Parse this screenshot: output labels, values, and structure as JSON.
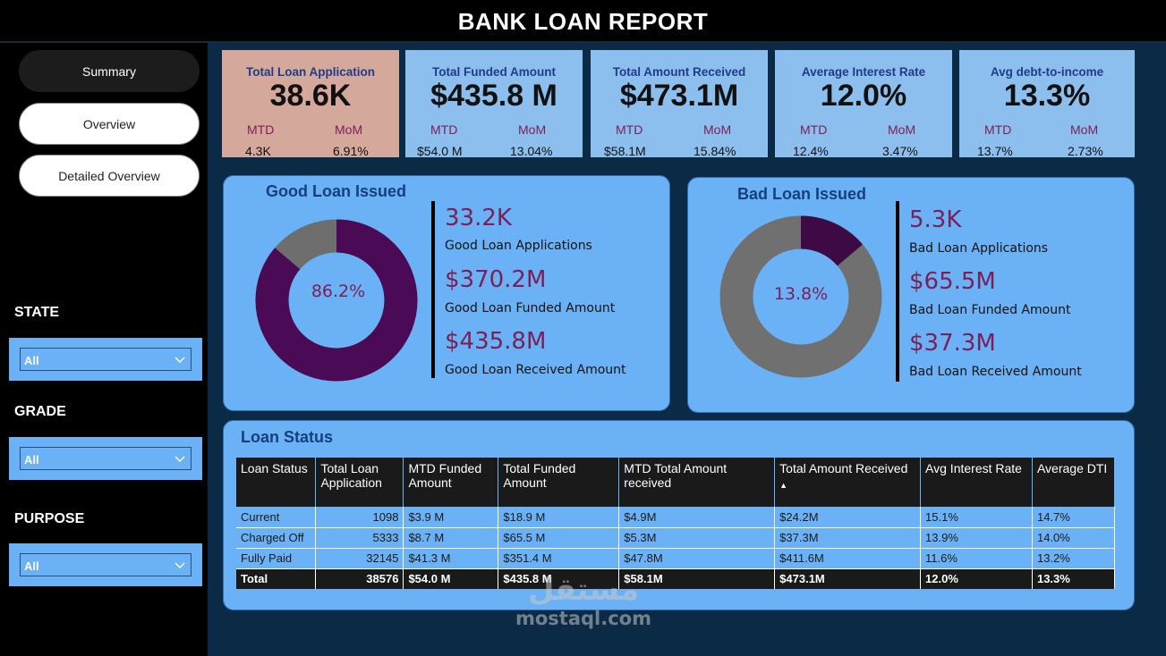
{
  "header": {
    "title": "BANK LOAN REPORT"
  },
  "nav": {
    "summary": "Summary",
    "overview": "Overview",
    "detailed": "Detailed Overview"
  },
  "filters": {
    "state": {
      "label": "STATE",
      "value": "All"
    },
    "grade": {
      "label": "GRADE",
      "value": "All"
    },
    "purpose": {
      "label": "PURPOSE",
      "value": "All"
    }
  },
  "kpis": [
    {
      "title": "Total Loan Application",
      "value": "38.6K",
      "mtd_label": "MTD",
      "mom_label": "MoM",
      "mtd": "4.3K",
      "mom": "6.91%"
    },
    {
      "title": "Total Funded Amount",
      "value": "$435.8 M",
      "mtd_label": "MTD",
      "mom_label": "MoM",
      "mtd": "$54.0 M",
      "mom": "13.04%"
    },
    {
      "title": "Total Amount Received",
      "value": "$473.1M",
      "mtd_label": "MTD",
      "mom_label": "MoM",
      "mtd": "$58.1M",
      "mom": "15.84%"
    },
    {
      "title": "Average Interest Rate",
      "value": "12.0%",
      "mtd_label": "MTD",
      "mom_label": "MoM",
      "mtd": "12.4%",
      "mom": "3.47%"
    },
    {
      "title": "Avg debt-to-income",
      "value": "13.3%",
      "mtd_label": "MTD",
      "mom_label": "MoM",
      "mtd": "13.7%",
      "mom": "2.73%"
    }
  ],
  "good_loan": {
    "title": "Good Loan Issued",
    "percent_label": "86.2%",
    "percent": 86.2,
    "applications": "33.2K",
    "applications_label": "Good Loan Applications",
    "funded": "$370.2M",
    "funded_label": "Good Loan Funded Amount",
    "received": "$435.8M",
    "received_label": "Good Loan Received Amount",
    "fill_color": "#4a0a55",
    "rest_color": "#6e6e6e"
  },
  "bad_loan": {
    "title": "Bad Loan Issued",
    "percent_label": "13.8%",
    "percent": 13.8,
    "applications": "5.3K",
    "applications_label": "Bad Loan Applications",
    "funded": "$65.5M",
    "funded_label": "Bad Loan Funded Amount",
    "received": "$37.3M",
    "received_label": "Bad Loan Received Amount",
    "fill_color": "#3d0a45",
    "rest_color": "#707070"
  },
  "loan_status": {
    "title": "Loan Status",
    "columns": [
      "Loan Status",
      "Total Loan Application",
      "MTD Funded Amount",
      "Total Funded Amount",
      "MTD Total Amount received",
      "Total Amount Received",
      "Avg Interest Rate",
      "Average DTI"
    ],
    "rows": [
      [
        "Current",
        "1098",
        "$3.9 M",
        "$18.9 M",
        "$4.9M",
        "$24.2M",
        "15.1%",
        "14.7%"
      ],
      [
        "Charged Off",
        "5333",
        "$8.7 M",
        "$65.5 M",
        "$5.3M",
        "$37.3M",
        "13.9%",
        "14.0%"
      ],
      [
        "Fully Paid",
        "32145",
        "$41.3 M",
        "$351.4 M",
        "$47.8M",
        "$411.6M",
        "11.6%",
        "13.2%"
      ]
    ],
    "total": [
      "Total",
      "38576",
      "$54.0 M",
      "$435.8 M",
      "$58.1M",
      "$473.1M",
      "12.0%",
      "13.3%"
    ]
  },
  "watermark": {
    "arabic": "مستقل",
    "latin": "mostaql.com"
  }
}
